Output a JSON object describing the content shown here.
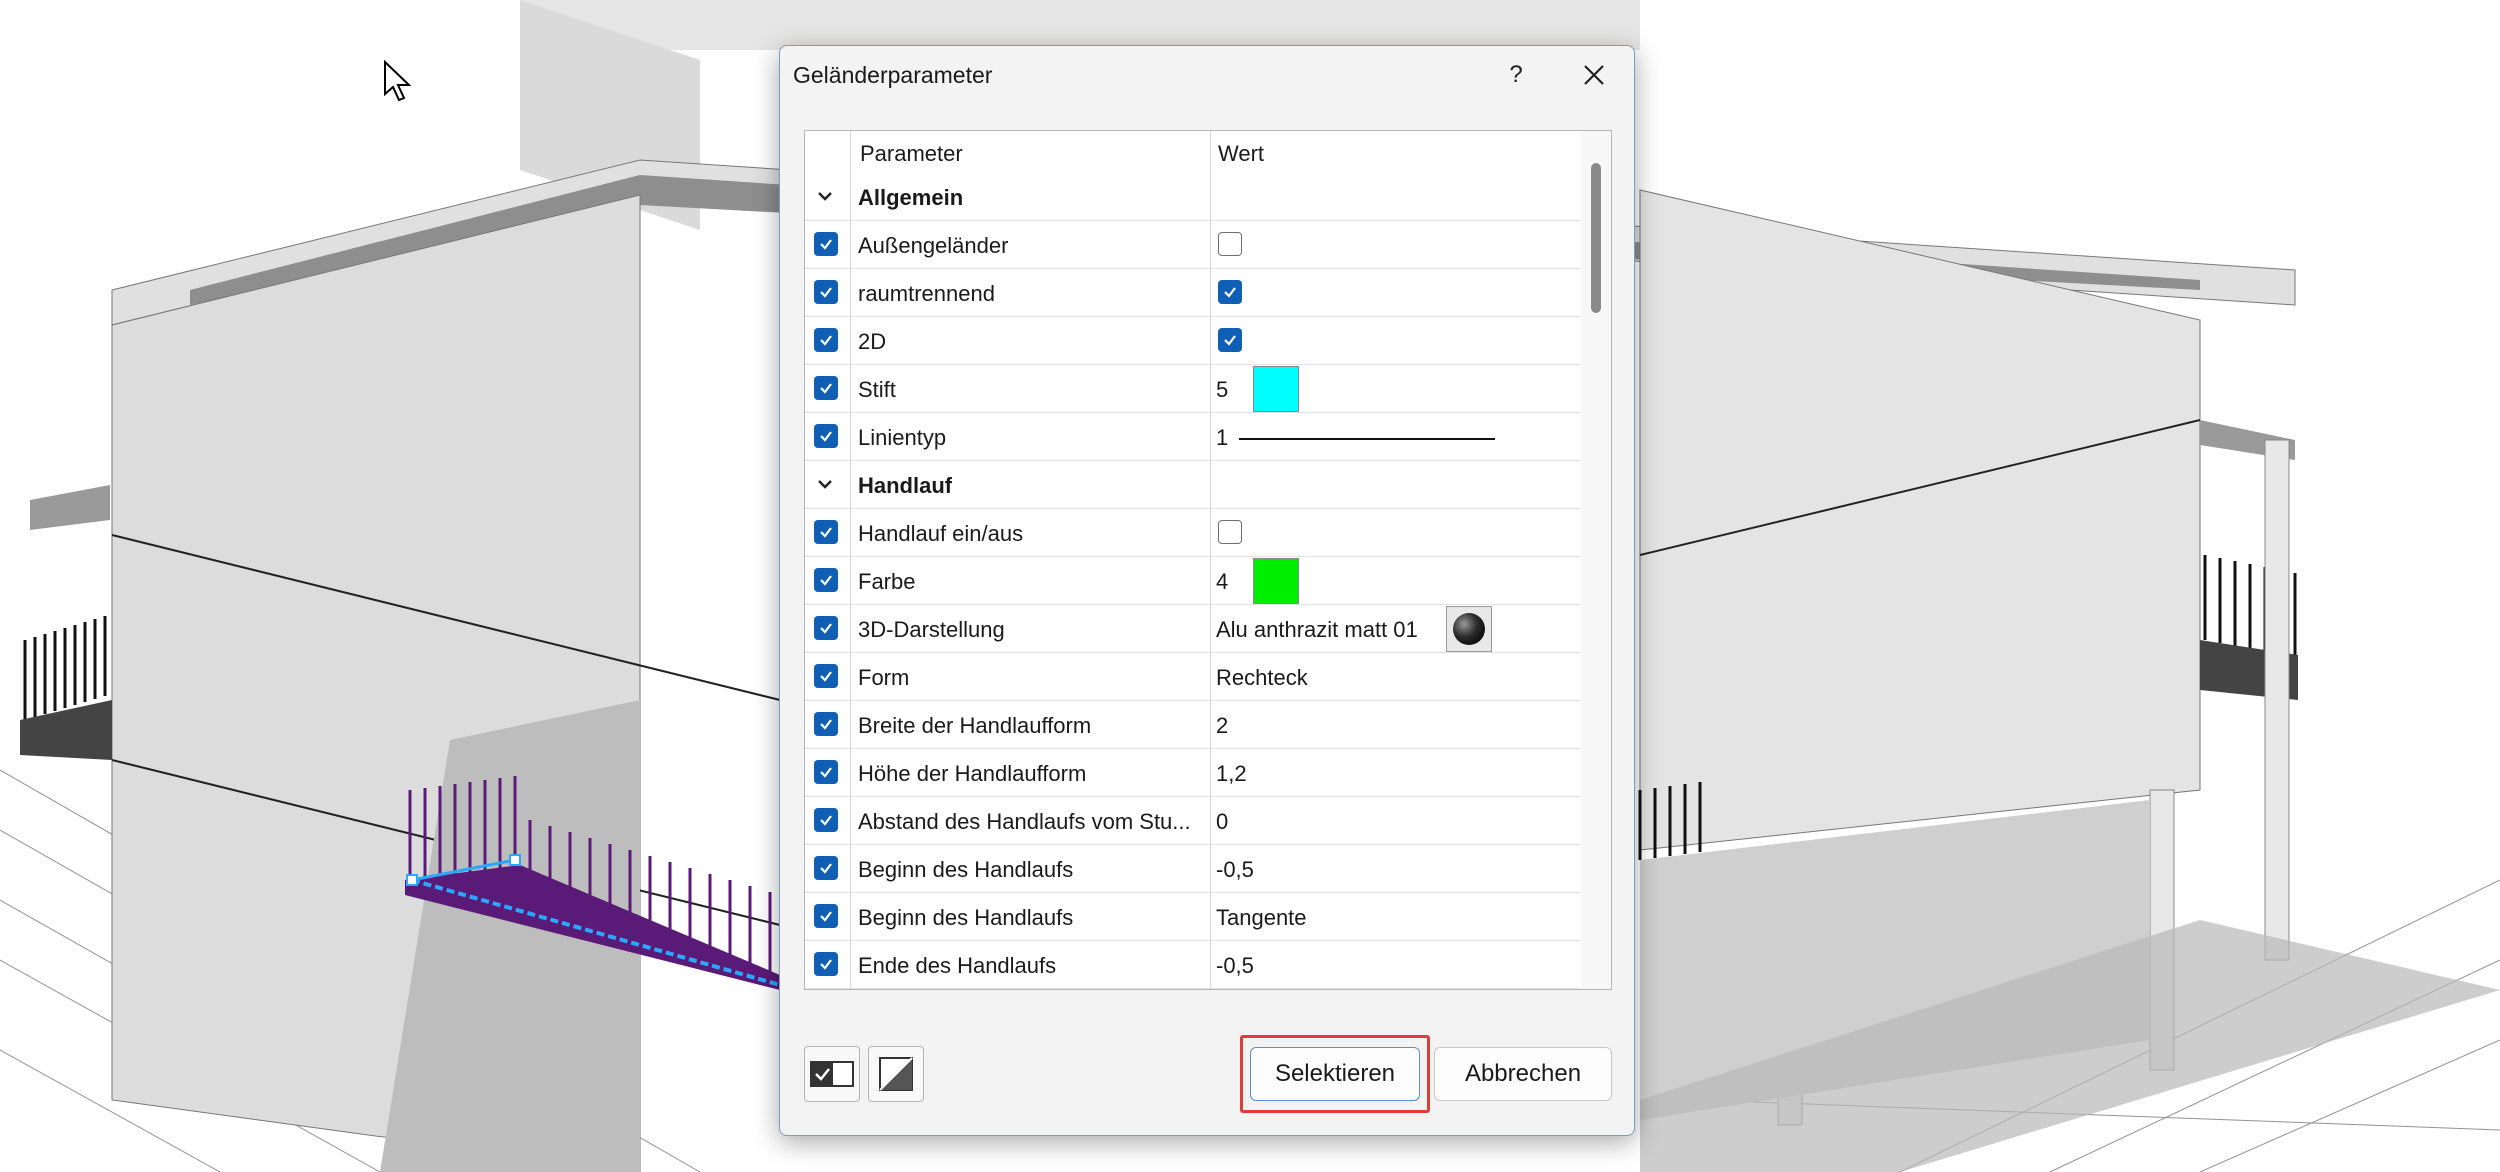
{
  "dialog": {
    "title": "Geländerparameter",
    "help_label": "?",
    "columns": {
      "parameter": "Parameter",
      "value": "Wert"
    },
    "rows": [
      {
        "type": "group",
        "label": "Allgemein"
      },
      {
        "type": "param",
        "label": "Außengeländer",
        "value_kind": "checkbox",
        "checked": false
      },
      {
        "type": "param",
        "label": "raumtrennend",
        "value_kind": "checkbox",
        "checked": true
      },
      {
        "type": "param",
        "label": "2D",
        "value_kind": "checkbox",
        "checked": true
      },
      {
        "type": "param",
        "label": "Stift",
        "value_kind": "color",
        "value": "5",
        "color": "#00ffff"
      },
      {
        "type": "param",
        "label": "Linientyp",
        "value_kind": "line",
        "value": "1"
      },
      {
        "type": "group",
        "label": "Handlauf"
      },
      {
        "type": "param",
        "label": "Handlauf ein/aus",
        "value_kind": "checkbox",
        "checked": false
      },
      {
        "type": "param",
        "label": "Farbe",
        "value_kind": "color",
        "value": "4",
        "color": "#00ee00"
      },
      {
        "type": "param",
        "label": "3D-Darstellung",
        "value_kind": "material",
        "value": "Alu anthrazit matt 01"
      },
      {
        "type": "param",
        "label": "Form",
        "value_kind": "text",
        "value": "Rechteck"
      },
      {
        "type": "param",
        "label": "Breite der Handlaufform",
        "value_kind": "text",
        "value": "2"
      },
      {
        "type": "param",
        "label": "Höhe der Handlaufform",
        "value_kind": "text",
        "value": "1,2"
      },
      {
        "type": "param",
        "label": "Abstand des Handlaufs vom Stu...",
        "value_kind": "text",
        "value": "0"
      },
      {
        "type": "param",
        "label": "Beginn des Handlaufs",
        "value_kind": "text",
        "value": "-0,5"
      },
      {
        "type": "param",
        "label": "Beginn des Handlaufs",
        "value_kind": "text",
        "value": "Tangente"
      },
      {
        "type": "param",
        "label": "Ende des Handlaufs",
        "value_kind": "text",
        "value": "-0,5"
      }
    ],
    "buttons": {
      "select": "Selektieren",
      "cancel": "Abbrechen"
    }
  },
  "colors": {
    "accent": "#0f5fb7",
    "highlight": "#e23b3b",
    "railing_selected": "#5a1a78",
    "selection_line": "#2aa8ff"
  }
}
